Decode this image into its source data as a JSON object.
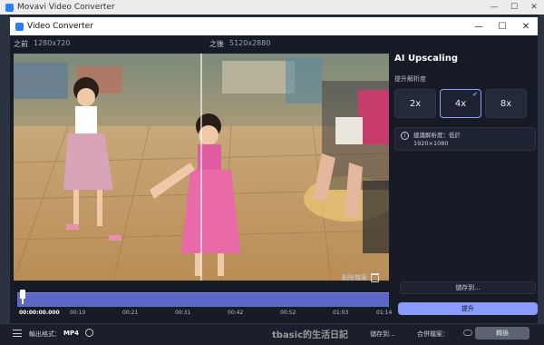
{
  "outer_window": {
    "title": "Movavi Video Converter",
    "controls": [
      "—",
      "☐",
      "✕"
    ]
  },
  "dialog": {
    "title": "Video Converter",
    "controls": [
      "—",
      "☐",
      "✕"
    ]
  },
  "before": {
    "label": "之前",
    "resolution": "1280x720"
  },
  "after": {
    "label": "之後",
    "resolution": "5120x2880"
  },
  "panel": {
    "title": "AI Upscaling",
    "scale_label": "提升解析度",
    "scales": [
      "2x",
      "4x",
      "8x"
    ],
    "selected_scale": "4x",
    "recommend_line1": "建議解析度：低於",
    "recommend_line2": "1920×1080"
  },
  "delete_label": "刪除檔案",
  "save_to_field": "儲存到...",
  "upscale_button": "提升",
  "timeline": {
    "current": "00:00:00.000",
    "ticks": [
      "00:10",
      "00:21",
      "00:31",
      "00:42",
      "00:52",
      "01:03",
      "01:14"
    ]
  },
  "bottom": {
    "format_label": "輸出格式：",
    "format_value": "MP4",
    "save_to": "儲存到...",
    "merge": "合併檔案：",
    "convert": "轉換"
  },
  "watermark": "tbasic的生活日記",
  "colors": {
    "accent": "#8a9dff",
    "timeline": "#5b68c6",
    "background": "#161b26"
  }
}
